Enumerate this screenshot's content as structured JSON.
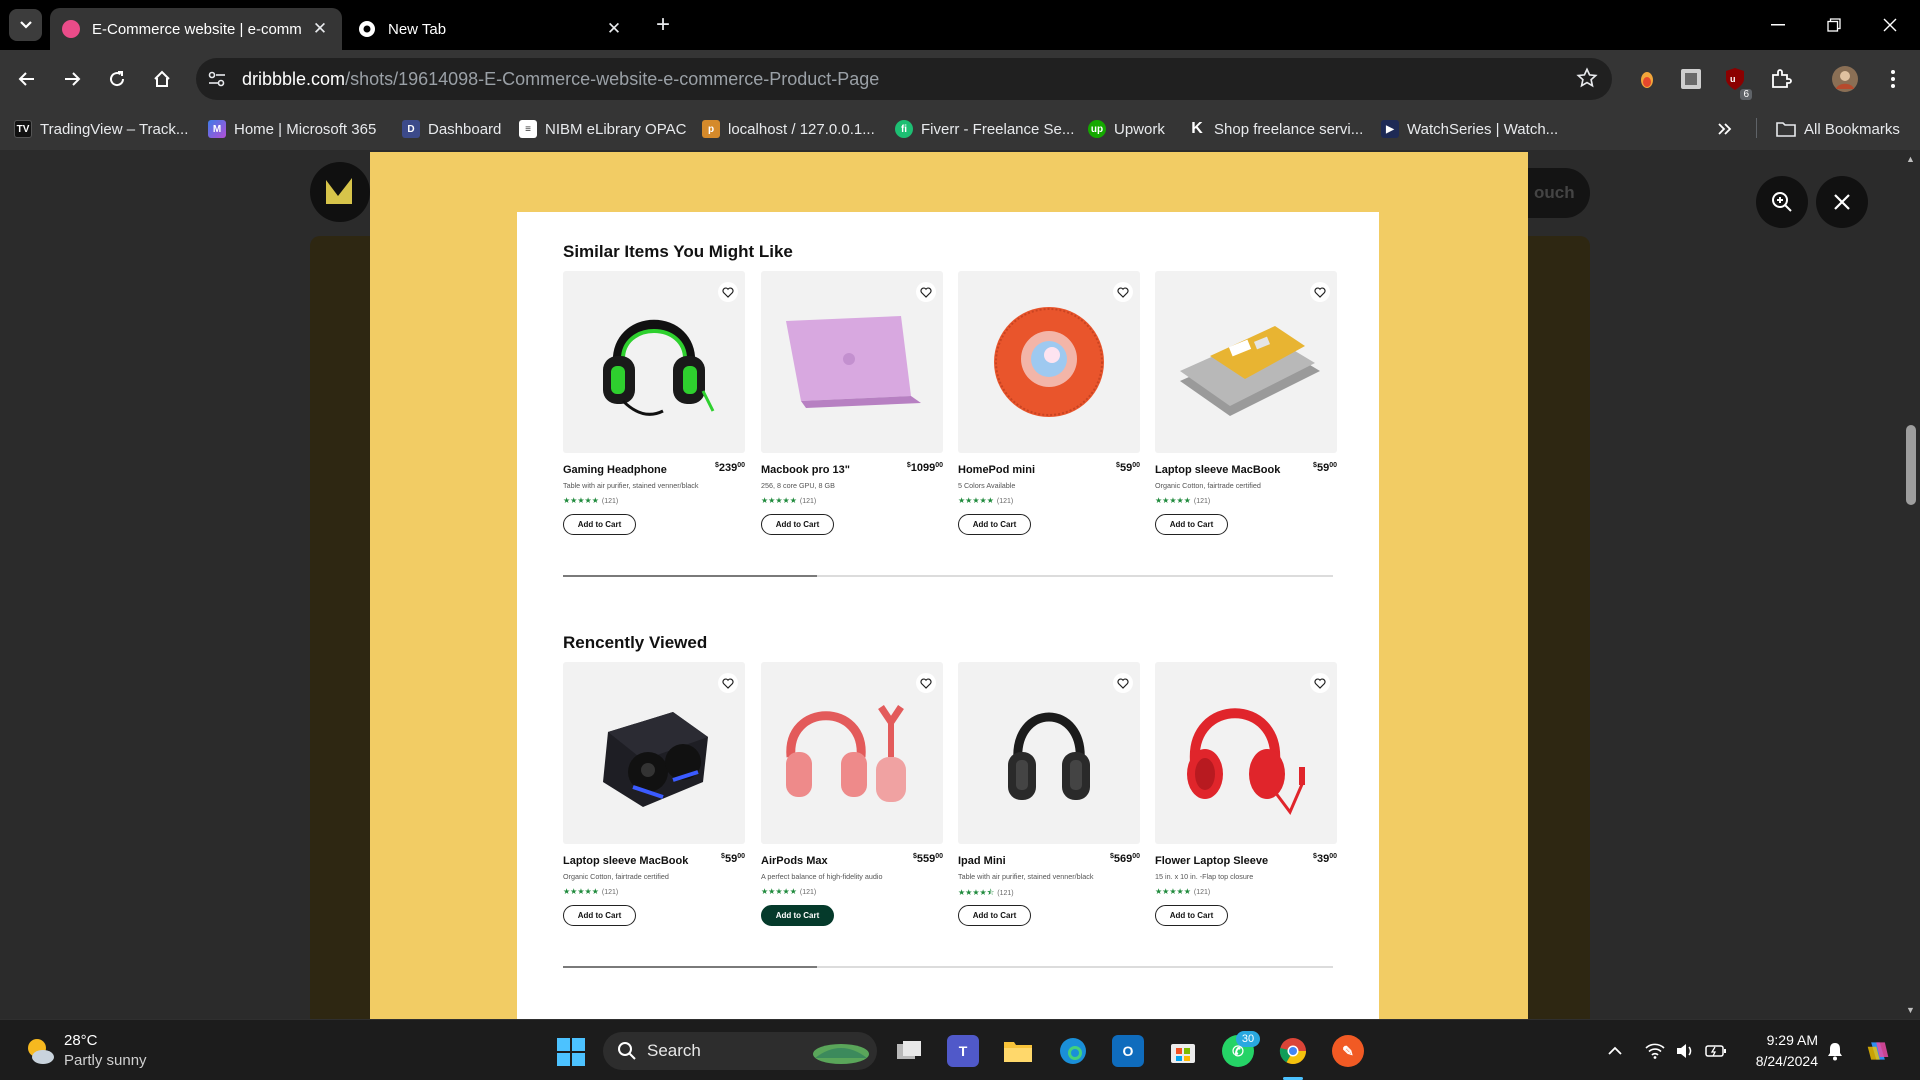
{
  "browser": {
    "tabs": [
      {
        "label": "E-Commerce website | e-comm",
        "active": true
      },
      {
        "label": "New Tab",
        "active": false
      }
    ],
    "url": {
      "domain": "dribbble.com",
      "path": "/shots/19614098-E-Commerce-website-e-commerce-Product-Page"
    },
    "extension_badge": "6"
  },
  "bookmarks": [
    {
      "label": "TradingView – Track...",
      "icon": "tradingview-icon"
    },
    {
      "label": "Home | Microsoft 365",
      "icon": "microsoft365-icon"
    },
    {
      "label": "Dashboard",
      "icon": "dashboard-icon"
    },
    {
      "label": "NIBM eLibrary OPAC",
      "icon": "library-icon"
    },
    {
      "label": "localhost / 127.0.0.1...",
      "icon": "phpmyadmin-icon"
    },
    {
      "label": "Fiverr - Freelance Se...",
      "icon": "fiverr-icon"
    },
    {
      "label": "Upwork",
      "icon": "upwork-icon"
    },
    {
      "label": "Shop freelance servi...",
      "icon": "kwork-icon"
    },
    {
      "label": "WatchSeries | Watch...",
      "icon": "watchseries-icon"
    }
  ],
  "all_bookmarks_label": "All Bookmarks",
  "page_behind": {
    "button_fragment": "ouch"
  },
  "shop": {
    "similar": {
      "title": "Similar Items You Might Like",
      "scroll_progress": 0.33,
      "items": [
        {
          "name": "Gaming Headphone",
          "price": "239",
          "cents": "00",
          "desc": "Table with air purifier, stained venner/black",
          "rating": 5,
          "reviews": "(121)",
          "cart": "Add to Cart",
          "highlight": false,
          "art": "gaming-headphone"
        },
        {
          "name": "Macbook pro 13\"",
          "price": "1099",
          "cents": "00",
          "desc": "256, 8 core GPU, 8 GB",
          "rating": 5,
          "reviews": "(121)",
          "cart": "Add to Cart",
          "highlight": false,
          "art": "macbook"
        },
        {
          "name": "HomePod mini",
          "price": "59",
          "cents": "00",
          "desc": "5 Colors Available",
          "rating": 5,
          "reviews": "(121)",
          "cart": "Add to Cart",
          "highlight": false,
          "art": "homepod"
        },
        {
          "name": "Laptop sleeve MacBook",
          "price": "59",
          "cents": "00",
          "desc": "Organic Cotton, fairtrade certified",
          "rating": 5,
          "reviews": "(121)",
          "cart": "Add to Cart",
          "highlight": false,
          "art": "sleeve"
        }
      ]
    },
    "recent": {
      "title": "Rencently Viewed",
      "scroll_progress": 0.33,
      "items": [
        {
          "name": "Laptop sleeve MacBook",
          "price": "59",
          "cents": "00",
          "desc": "Organic Cotton, fairtrade certified",
          "rating": 5,
          "reviews": "(121)",
          "cart": "Add to Cart",
          "highlight": false,
          "art": "earbuds"
        },
        {
          "name": "AirPods Max",
          "price": "559",
          "cents": "00",
          "desc": "A perfect balance of high-fidelity audio",
          "rating": 5,
          "reviews": "(121)",
          "cart": "Add to Cart",
          "highlight": true,
          "art": "airpods-max"
        },
        {
          "name": "Ipad Mini",
          "price": "569",
          "cents": "00",
          "desc": "Table with air purifier, stained venner/black",
          "rating": 4.5,
          "reviews": "(121)",
          "cart": "Add to Cart",
          "highlight": false,
          "art": "black-headphone"
        },
        {
          "name": "Flower Laptop Sleeve",
          "price": "39",
          "cents": "00",
          "desc": "15 in. x 10 in. -Flap top closure",
          "rating": 5,
          "reviews": "(121)",
          "cart": "Add to Cart",
          "highlight": false,
          "art": "red-headphone"
        }
      ]
    }
  },
  "taskbar": {
    "weather": {
      "temp": "28°C",
      "desc": "Partly sunny"
    },
    "search_label": "Search",
    "whatsapp_badge": "30",
    "time": "9:29 AM",
    "date": "8/24/2024"
  },
  "colors": {
    "modal_bg": "#f2cc64",
    "accent_dark": "#053a2b",
    "star": "#1f8a3c"
  }
}
